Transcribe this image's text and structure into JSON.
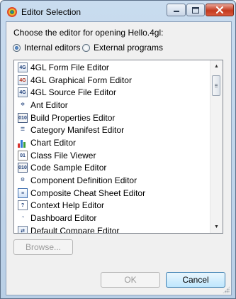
{
  "window": {
    "title": "Editor Selection",
    "icon": "eclipse-colorful-icon",
    "controls": [
      "minimize-icon",
      "maximize-icon",
      "close-icon"
    ]
  },
  "prompt": "Choose the editor for opening Hello.4gl:",
  "radios": {
    "internal": {
      "label": "Internal editors",
      "checked": true
    },
    "external": {
      "label": "External programs",
      "checked": false
    }
  },
  "editors": [
    {
      "label": "4GL Form File Editor",
      "icon": "4gl-form-file-icon"
    },
    {
      "label": "4GL Graphical Form Editor",
      "icon": "4gl-graphical-form-icon"
    },
    {
      "label": "4GL Source File Editor",
      "icon": "4gl-source-file-icon"
    },
    {
      "label": "Ant Editor",
      "icon": "ant-icon"
    },
    {
      "label": "Build Properties Editor",
      "icon": "binary-010-icon"
    },
    {
      "label": "Category Manifest Editor",
      "icon": "category-manifest-icon"
    },
    {
      "label": "Chart Editor",
      "icon": "bar-chart-icon"
    },
    {
      "label": "Class File Viewer",
      "icon": "class-file-icon"
    },
    {
      "label": "Code Sample Editor",
      "icon": "binary-010-icon"
    },
    {
      "label": "Component Definition Editor",
      "icon": "component-definition-icon"
    },
    {
      "label": "Composite Cheat Sheet Editor",
      "icon": "cheat-sheet-icon"
    },
    {
      "label": "Context Help Editor",
      "icon": "context-help-icon"
    },
    {
      "label": "Dashboard Editor",
      "icon": "dashboard-icon"
    },
    {
      "label": "Default Compare Editor",
      "icon": "compare-icon"
    }
  ],
  "buttons": {
    "browse": "Browse...",
    "ok": "OK",
    "cancel": "Cancel"
  }
}
